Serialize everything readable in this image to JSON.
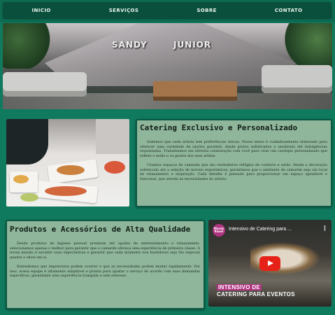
{
  "nav": {
    "items": [
      "INICIO",
      "SERVIÇOS",
      "SOBRE",
      "CONTATO"
    ]
  },
  "hero": {
    "brand_left": "SANDY",
    "brand_right": "JUNIOR"
  },
  "catering": {
    "title": "Catering Exclusivo e Personalizado",
    "paragraph1": "Sabemos que cada artista tem preferências únicas. Nosso menu é cuidadosamente elaborado para oferecer uma variedade de opções gourmet, desde pratos sofisticados e saudáveis até indulgências requintadas. Trabalhamos em estreita colaboração com você para criar um cardápio personalizado que reflete o estilo e os gostos dos seus artista",
    "paragraph2": "Criamos espaços de camarim que são verdadeiros refúgios de conforto e estilo. Desde a decoração sofisticada até a seleção de móveis ergonômicos, garantimos que o ambiente de camarim seja um local de relaxamento e inspiração. Cada detalhe é pensado para proporcionar um espaço agradável e funcional, que atenda às necessidades do artista."
  },
  "products": {
    "title": "Produtos e Acessórios de Alta Qualidade",
    "paragraph1": "Desde produtos de higiene pessoal premium até opções de entretenimento e relaxamento, selecionamos apenas o melhor para garantir que o camarim ofereça uma experiência de primeira classe. A nossa missão é exceder suas expectativas e garantir que cada momento nos bastidores seja tão especial quanto o show em si.",
    "paragraph2": "Entendemos que imprevistos podem ocorrer e que as necessidades podem mudar rapidamente. Por isso, nossa equipe é altamente adaptável e pronta para ajustar o serviço de acordo com suas demandas específicas, garantindo uma experiência tranquila e sem estresse."
  },
  "video": {
    "logo_text": "Marah Rauel",
    "title": "Intensivo de Catering para ...",
    "caption_line1": "INTENSIVO DE",
    "caption_line2": "CATERING PARA EVENTOS"
  }
}
